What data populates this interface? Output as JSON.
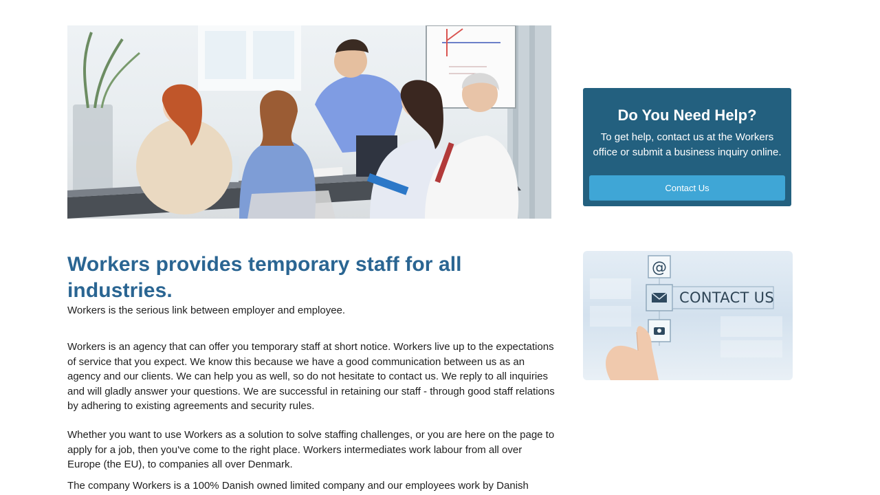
{
  "hero": {
    "image": "business-meeting-photo"
  },
  "main": {
    "headline": "Workers provides temporary staff for all industries.",
    "intro": "Workers is the serious link between employer and employee.",
    "body": "Workers is an agency that can offer you temporary staff at short notice. Workers live up to the expectations of service that you expect. We know this because we have a good communication between us as an agency and our clients. We can help you as well, so do not hesitate to contact us. We reply to all inquiries and will gladly answer your questions. We are successful in retaining our staff - through good staff relations by adhering to existing agreements and security rules.",
    "solution": "Whether you want to use Workers as a solution to solve staffing challenges, or you are here on the page to apply for a job, then you've come to the right place. Workers intermediates work labour from all over Europe (the EU), to companies all over Denmark.",
    "company": "The company Workers is a 100% Danish owned limited company and our employees work by Danish"
  },
  "help": {
    "title": "Do You Need Help?",
    "text": "To get help, contact us at the Workers office or submit a business inquiry online.",
    "button_label": "Contact Us"
  },
  "contact_image": {
    "label": "CONTACT US",
    "icons": [
      "at-sign-icon",
      "envelope-icon",
      "phone-icon"
    ]
  },
  "colors": {
    "headline": "#2a6592",
    "help_box": "#23607f",
    "button": "#3fa6d6"
  }
}
